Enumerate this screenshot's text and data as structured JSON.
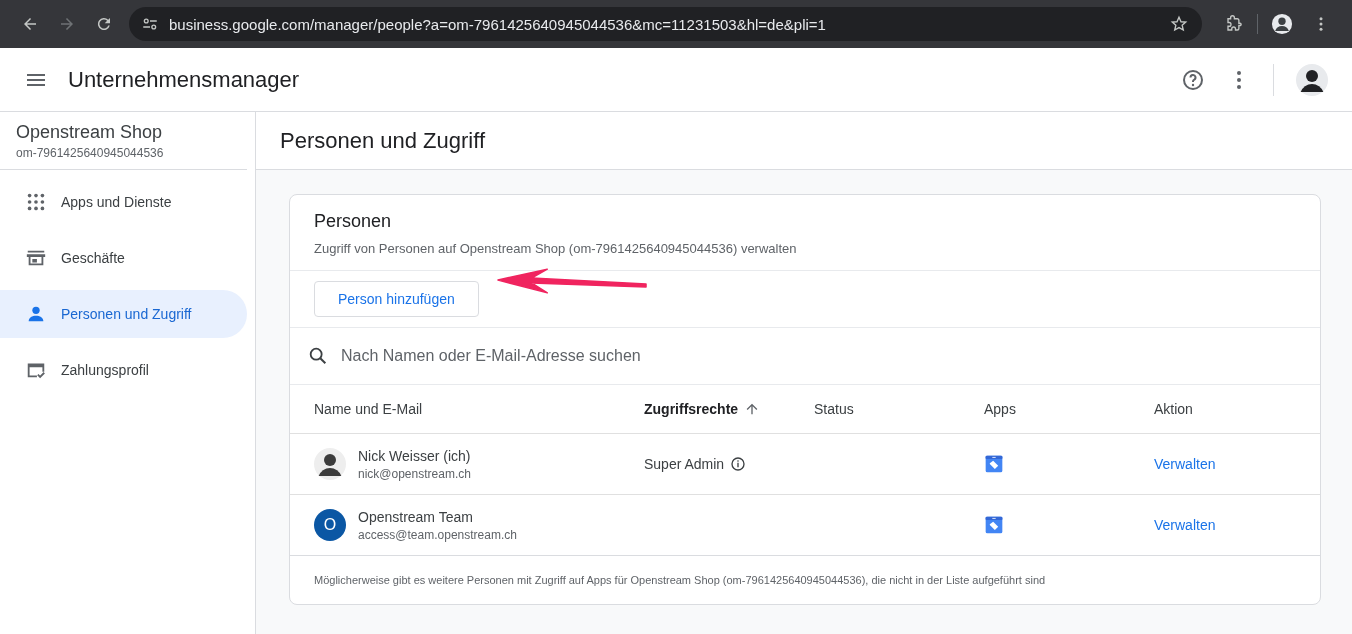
{
  "browser": {
    "url": "business.google.com/manager/people?a=om-7961425640945044536&mc=11231503&hl=de&pli=1"
  },
  "app_bar": {
    "title": "Unternehmensmanager"
  },
  "sidebar": {
    "account_name": "Openstream Shop",
    "account_id": "om-7961425640945044536",
    "items": [
      {
        "label": "Apps und Dienste",
        "selected": false
      },
      {
        "label": "Geschäfte",
        "selected": false
      },
      {
        "label": "Personen und Zugriff",
        "selected": true
      },
      {
        "label": "Zahlungsprofil",
        "selected": false
      }
    ]
  },
  "page": {
    "title": "Personen und Zugriff"
  },
  "card": {
    "title": "Personen",
    "subtitle": "Zugriff von Personen auf Openstream Shop (om-7961425640945044536) verwalten",
    "add_button": "Person hinzufügen",
    "search": {
      "placeholder": "Nach Namen oder E-Mail-Adresse suchen"
    },
    "table": {
      "columns": [
        {
          "label": "Name und E-Mail",
          "sorted": false
        },
        {
          "label": "Zugriffsrechte",
          "sorted": true
        },
        {
          "label": "Status",
          "sorted": false
        },
        {
          "label": "Apps",
          "sorted": false
        },
        {
          "label": "Aktion",
          "sorted": false
        }
      ],
      "rows": [
        {
          "avatar": {
            "kind": "photo"
          },
          "name": "Nick Weisser (ich)",
          "email": "nick@openstream.ch",
          "role": "Super Admin",
          "action": "Verwalten"
        },
        {
          "avatar": {
            "kind": "letter",
            "initial": "O"
          },
          "name": "Openstream Team",
          "email": "access@team.openstream.ch",
          "action": "Verwalten"
        }
      ]
    },
    "footer_note": "Möglicherweise gibt es weitere Personen mit Zugriff auf Apps für Openstream Shop (om-7961425640945044536), die nicht in der Liste aufgeführt sind"
  }
}
